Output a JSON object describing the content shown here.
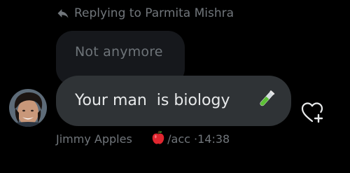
{
  "reply_context": {
    "prefix": "Replying to ",
    "name": "Parmita Mishra",
    "icon": "reply-arrow-icon"
  },
  "quoted_message": {
    "text": "Not anymore"
  },
  "message": {
    "text": "Your man  is biology",
    "emoji": "test-tube-icon"
  },
  "sender": {
    "name": "Jimmy Apples",
    "emoji": "red-apple-icon",
    "handle_suffix": "/acc",
    "separator": " ·",
    "time": "14:38"
  },
  "actions": {
    "react_icon": "heart-plus-icon"
  },
  "colors": {
    "background": "#000000",
    "bubble": "#2f3336",
    "quoted_bubble": "#16181c",
    "muted_text": "#71767b",
    "primary_text": "#e7e9ea"
  }
}
